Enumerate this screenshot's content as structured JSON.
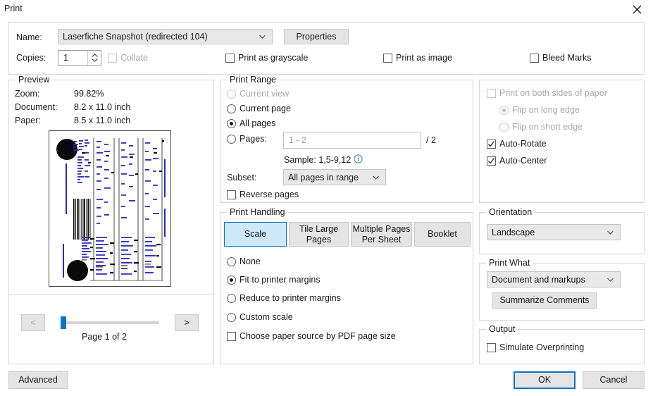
{
  "window": {
    "title": "Print",
    "close_icon": "close-icon"
  },
  "printer": {
    "name_label": "Name:",
    "printer_value": "Laserfiche Snapshot (redirected 104)",
    "properties_label": "Properties",
    "copies_label": "Copies:",
    "copies_value": "1",
    "collate_label": "Collate",
    "print_as_grayscale_label": "Print as grayscale",
    "print_as_image_label": "Print as image",
    "bleed_marks_label": "Bleed Marks"
  },
  "preview": {
    "legend": "Preview",
    "zoom_label": "Zoom:",
    "zoom_value": "99.82%",
    "document_label": "Document:",
    "document_value": "8.2 x 11.0 inch",
    "paper_label": "Paper:",
    "paper_value": "8.5 x 11.0 inch",
    "prev_label": "<",
    "next_label": ">",
    "page_status": "Page 1 of 2"
  },
  "print_range": {
    "legend": "Print Range",
    "current_view_label": "Current view",
    "current_page_label": "Current page",
    "all_pages_label": "All pages",
    "pages_label": "Pages:",
    "pages_placeholder": "1 - 2",
    "pages_total": "/ 2",
    "sample_label": "Sample: 1,5-9,12",
    "info_icon": "info-icon",
    "subset_label": "Subset:",
    "subset_value": "All pages in range",
    "reverse_pages_label": "Reverse pages"
  },
  "print_handling": {
    "legend": "Print Handling",
    "tabs": [
      {
        "label": "Scale",
        "selected": true
      },
      {
        "label": "Tile Large Pages",
        "selected": false
      },
      {
        "label": "Multiple Pages Per Sheet",
        "selected": false
      },
      {
        "label": "Booklet",
        "selected": false
      }
    ],
    "none_label": "None",
    "fit_label": "Fit to printer margins",
    "reduce_label": "Reduce to printer margins",
    "custom_label": "Custom scale",
    "paper_source_label": "Choose paper source by PDF page size"
  },
  "duplex": {
    "both_sides_label": "Print on both sides of paper",
    "flip_long_label": "Flip on long edge",
    "flip_short_label": "Flip on short edge",
    "auto_rotate_label": "Auto-Rotate",
    "auto_center_label": "Auto-Center"
  },
  "orientation": {
    "legend": "Orientation",
    "value": "Landscape"
  },
  "print_what": {
    "legend": "Print What",
    "value": "Document and markups",
    "summarize_label": "Summarize Comments"
  },
  "output": {
    "legend": "Output",
    "simulate_overprinting_label": "Simulate Overprinting"
  },
  "footer": {
    "advanced_label": "Advanced",
    "ok_label": "OK",
    "cancel_label": "Cancel"
  },
  "colors": {
    "accent_blue": "#0a74c4",
    "selected_tab_fill": "#cde8fa",
    "selected_tab_border": "#1171bb",
    "panel_border": "#d6d6d6",
    "disabled_text": "#a8a8a8"
  }
}
